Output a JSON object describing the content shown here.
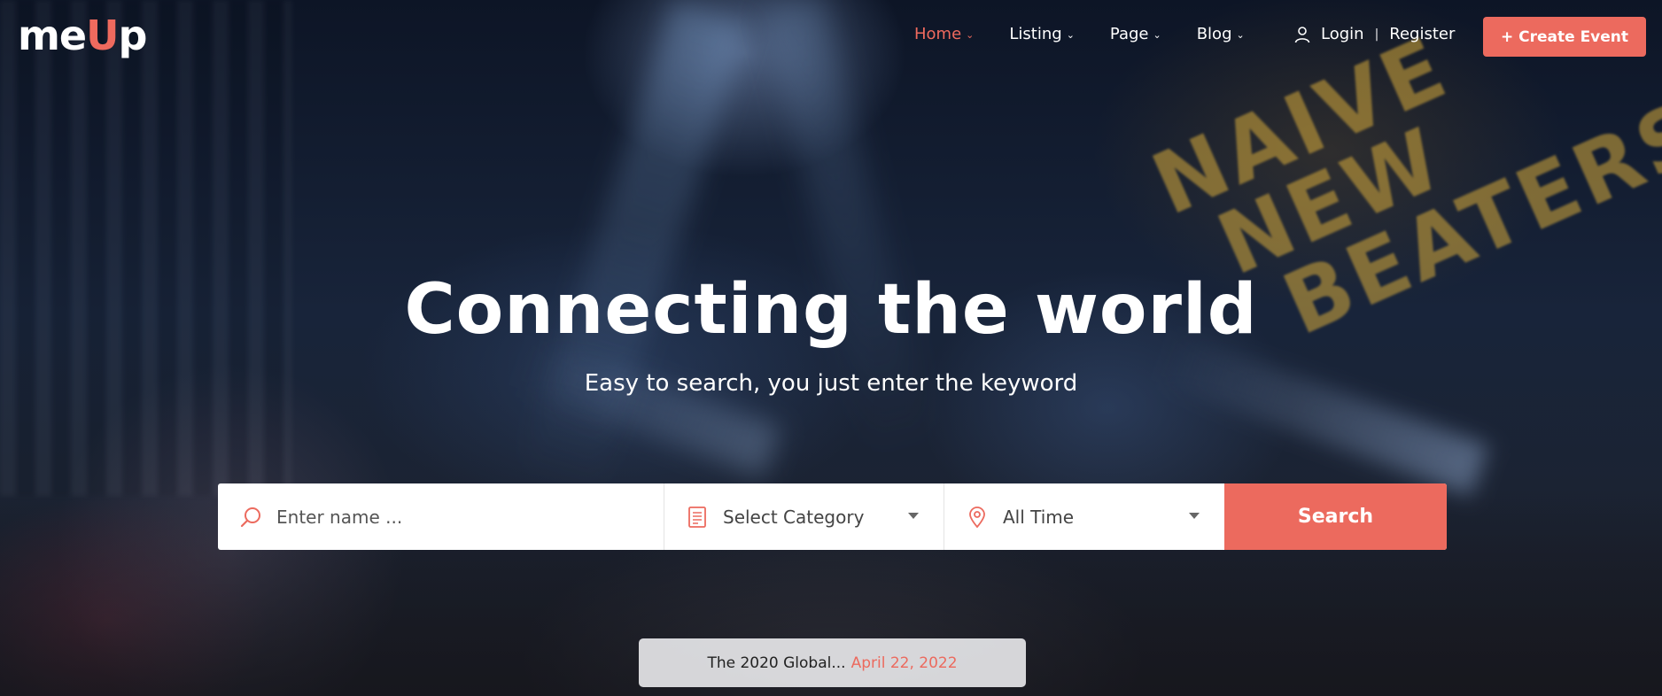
{
  "brand": {
    "logo_left": "me",
    "logo_accent": "U",
    "logo_right": "p"
  },
  "nav": {
    "items": [
      {
        "label": "Home",
        "active": true
      },
      {
        "label": "Listing",
        "active": false
      },
      {
        "label": "Page",
        "active": false
      },
      {
        "label": "Blog",
        "active": false
      }
    ],
    "login": "Login",
    "separator": "|",
    "register": "Register",
    "create_event": "+ Create Event"
  },
  "hero": {
    "title": "Connecting the world",
    "subtitle": "Easy to search, you just enter the keyword"
  },
  "search": {
    "name_placeholder": "Enter name ...",
    "category_value": "Select Category",
    "time_value": "All Time",
    "button": "Search"
  },
  "ticker": {
    "text": "The 2020 Global...",
    "date": "April 22, 2022"
  },
  "background_sign": [
    "NAIVE",
    "NEW",
    "BEATERS"
  ],
  "colors": {
    "accent": "#ec6a5e",
    "text_light": "#ffffff"
  },
  "icons": [
    "user-icon",
    "search-icon",
    "category-icon",
    "location-pin-icon",
    "chevron-down-icon"
  ]
}
